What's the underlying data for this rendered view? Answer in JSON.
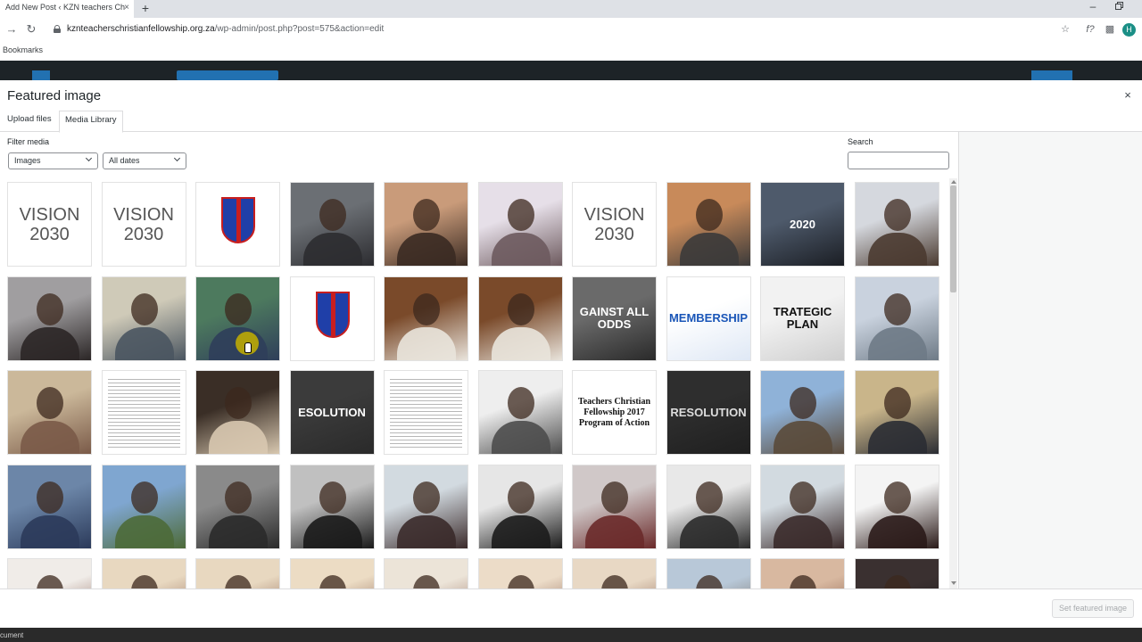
{
  "browser": {
    "tab_title": "Add New Post ‹ KZN teachers Ch",
    "tab_close": "×",
    "new_tab": "+",
    "url_domain": "kznteacherschristianfellowship.org.za",
    "url_path": "/wp-admin/post.php?post=575&action=edit",
    "bookmarks_label": "Bookmarks",
    "avatar_letter": "H",
    "minimize": "–"
  },
  "modal": {
    "title": "Featured image",
    "close_label": "×",
    "tabs": [
      {
        "label": "Upload files",
        "active": false
      },
      {
        "label": "Media Library",
        "active": true
      }
    ],
    "filter_label": "Filter media",
    "type_filter": {
      "selected": "Images"
    },
    "date_filter": {
      "selected": "All dates"
    },
    "search_label": "Search",
    "search_value": "",
    "set_button": "Set featured image"
  },
  "statusbar_text": "cument",
  "colors": {
    "wp_blue": "#2271b1",
    "admin_bar": "#1d2327",
    "avatar_green": "#1b8f86"
  },
  "media": [
    {
      "kind": "vision",
      "text": "VISION 2030"
    },
    {
      "kind": "vision",
      "text": "VISION 2030"
    },
    {
      "kind": "logo",
      "text": ""
    },
    {
      "kind": "photo",
      "text": "",
      "c1": "#6b6f74",
      "c2": "#2c2c30"
    },
    {
      "kind": "photo",
      "text": "",
      "c1": "#c99b7a",
      "c2": "#3a2a22"
    },
    {
      "kind": "photo",
      "text": "",
      "c1": "#e6dfe8",
      "c2": "#6d5a5e"
    },
    {
      "kind": "vision",
      "text": "VISION 2030"
    },
    {
      "kind": "photo",
      "text": "",
      "c1": "#c88a5a",
      "c2": "#3b3a3a"
    },
    {
      "kind": "text",
      "text": "2020",
      "c1": "#4e5a6b",
      "c2": "#1b1e24",
      "fg": "#ffffff"
    },
    {
      "kind": "photo",
      "text": "",
      "c1": "#d5d8de",
      "c2": "#4a3a30"
    },
    {
      "kind": "photo",
      "text": "",
      "c1": "#a09ea0",
      "c2": "#2b2626"
    },
    {
      "kind": "photo",
      "text": "",
      "c1": "#cfcab8",
      "c2": "#4a5560"
    },
    {
      "kind": "photo",
      "text": "",
      "c1": "#4d7a5e",
      "c2": "#2f3e5a"
    },
    {
      "kind": "logo",
      "text": ""
    },
    {
      "kind": "photo",
      "text": "",
      "c1": "#7a4a2a",
      "c2": "#e9e4dc"
    },
    {
      "kind": "photo",
      "text": "",
      "c1": "#7a4a2a",
      "c2": "#e9e4dc"
    },
    {
      "kind": "text",
      "text": "GAINST ALL ODDS",
      "c1": "#6a6a6a",
      "c2": "#2a2a2a",
      "fg": "#ffffff"
    },
    {
      "kind": "text",
      "text": "MEMBERSHIP",
      "c1": "#ffffff",
      "c2": "#dfe8f5",
      "fg": "#1a56b8"
    },
    {
      "kind": "text",
      "text": "TRATEGIC PLAN",
      "c1": "#f2f2f2",
      "c2": "#cfcfcf",
      "fg": "#111111"
    },
    {
      "kind": "photo",
      "text": "",
      "c1": "#c9d2de",
      "c2": "#6e7a86"
    },
    {
      "kind": "photo",
      "text": "",
      "c1": "#cbb89a",
      "c2": "#7a5a48"
    },
    {
      "kind": "doc",
      "text": ""
    },
    {
      "kind": "photo",
      "text": "",
      "c1": "#3a2e26",
      "c2": "#d8c8b0"
    },
    {
      "kind": "text",
      "text": "ESOLUTION",
      "c1": "#3b3b3b",
      "c2": "#2a2a2a",
      "fg": "#ffffff"
    },
    {
      "kind": "doc",
      "text": ""
    },
    {
      "kind": "photo",
      "text": "",
      "c1": "#eeeeee",
      "c2": "#4c4c4c"
    },
    {
      "kind": "text",
      "text": "Teachers Christian Fellowship 2017 Program of Action",
      "c1": "#ffffff",
      "c2": "#ffffff",
      "fg": "#111111"
    },
    {
      "kind": "text",
      "text": "RESOLUTION",
      "c1": "#2e2e2e",
      "c2": "#1f1f1f",
      "fg": "#dddddd"
    },
    {
      "kind": "photo",
      "text": "",
      "c1": "#8fb2d8",
      "c2": "#5a4a3a"
    },
    {
      "kind": "photo",
      "text": "",
      "c1": "#c9b58a",
      "c2": "#2a2c33"
    },
    {
      "kind": "photo",
      "text": "",
      "c1": "#6c86a8",
      "c2": "#2b3a5a"
    },
    {
      "kind": "photo",
      "text": "",
      "c1": "#7fa6d0",
      "c2": "#4d6a38"
    },
    {
      "kind": "photo",
      "text": "",
      "c1": "#8a8a8a",
      "c2": "#2a2a2a"
    },
    {
      "kind": "photo",
      "text": "",
      "c1": "#c0c0c0",
      "c2": "#1a1a1a"
    },
    {
      "kind": "photo",
      "text": "",
      "c1": "#d2dae0",
      "c2": "#3a2a2a"
    },
    {
      "kind": "photo",
      "text": "",
      "c1": "#e6e6e6",
      "c2": "#1b1b1b"
    },
    {
      "kind": "photo",
      "text": "",
      "c1": "#d0c8c8",
      "c2": "#6a2a2a"
    },
    {
      "kind": "photo",
      "text": "",
      "c1": "#e8e8e8",
      "c2": "#2a2a2a"
    },
    {
      "kind": "photo",
      "text": "",
      "c1": "#d2dae0",
      "c2": "#3a2a2a"
    },
    {
      "kind": "photo",
      "text": "",
      "c1": "#f4f4f4",
      "c2": "#2a1a18"
    },
    {
      "kind": "photo",
      "text": "",
      "c1": "#f0ece8",
      "c2": "#6a3a2a"
    },
    {
      "kind": "photo",
      "text": "",
      "c1": "#e8d8c0",
      "c2": "#7a4a3a"
    },
    {
      "kind": "photo",
      "text": "",
      "c1": "#e8d8c0",
      "c2": "#6a3a2a"
    },
    {
      "kind": "photo",
      "text": "",
      "c1": "#ecdcc4",
      "c2": "#6a3a2a"
    },
    {
      "kind": "photo",
      "text": "",
      "c1": "#ece4d8",
      "c2": "#7a4a3a"
    },
    {
      "kind": "photo",
      "text": "",
      "c1": "#ecdcc8",
      "c2": "#6a3a2a"
    },
    {
      "kind": "photo",
      "text": "",
      "c1": "#e8d8c4",
      "c2": "#6a3a2a"
    },
    {
      "kind": "photo",
      "text": "",
      "c1": "#b8c8d8",
      "c2": "#5a4a3a"
    },
    {
      "kind": "photo",
      "text": "",
      "c1": "#d8b8a0",
      "c2": "#6a3a2a"
    },
    {
      "kind": "photo",
      "text": "",
      "c1": "#3a3030",
      "c2": "#1a1a1a"
    }
  ]
}
